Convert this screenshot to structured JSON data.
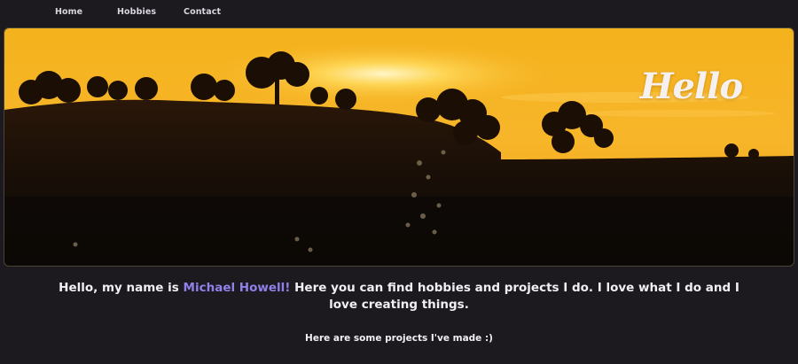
{
  "nav": {
    "items": [
      "Home",
      "Hobbies",
      "Contact"
    ]
  },
  "hero": {
    "heading": "Hello",
    "image": "sunset-silhouette-landscape"
  },
  "intro": {
    "prefix": "Hello, my name is ",
    "name": "Michael Howell!",
    "suffix": " Here you can find hobbies and projects I do. I love what I do and I love creating things."
  },
  "projects": {
    "heading": "Here are some projects I've made :)"
  },
  "colors": {
    "background": "#1c1a1f",
    "name_accent": "#8f80ea",
    "text": "#f1eef4"
  }
}
